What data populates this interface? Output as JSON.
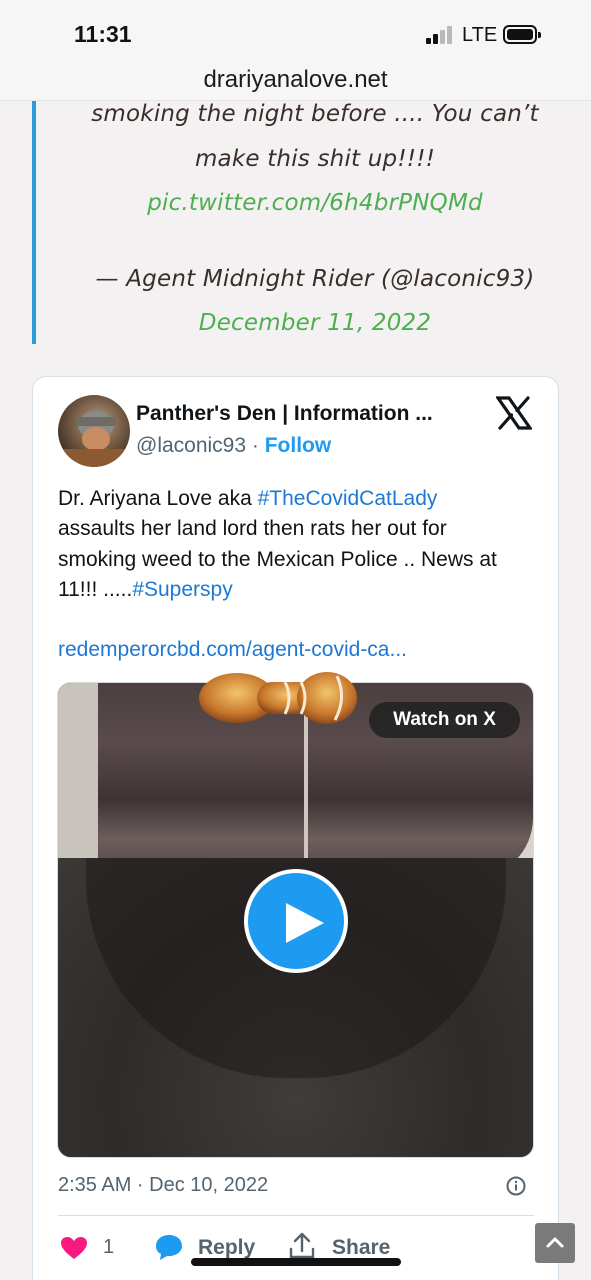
{
  "status_bar": {
    "time": "11:31",
    "network": "LTE"
  },
  "browser": {
    "url": "drariyanalove.net"
  },
  "quote": {
    "line1": "smoking the night before .... You can’t",
    "line2": "make this shit up!!!!",
    "pic_link": "pic.twitter.com/6h4brPNQMd",
    "attribution": "— Agent Midnight Rider (@laconic93)",
    "date": "December 11, 2022"
  },
  "tweet": {
    "author_name": "Panther's Den | Information ...",
    "handle": "@laconic93",
    "separator": "·",
    "follow_label": "Follow",
    "text": {
      "line1_prefix": "Dr. Ariyana Love aka ",
      "hashtag1": "#TheCovidCatLady",
      "line2": "assaults her land lord then rats her out for",
      "line3": "smoking weed to the Mexican Police .. News at",
      "line4_prefix": "11!!! .....",
      "hashtag2": "#Superspy"
    },
    "link": "redemperorcbd.com/agent-covid-ca...",
    "watch_label": "Watch on X",
    "timestamp": "2:35 AM · Dec 10, 2022",
    "like_count": "1",
    "reply_label": "Reply",
    "share_label": "Share"
  },
  "colors": {
    "accent_blue": "#1d9bf0",
    "link_green": "#4fae51",
    "like_red": "#f91880"
  }
}
